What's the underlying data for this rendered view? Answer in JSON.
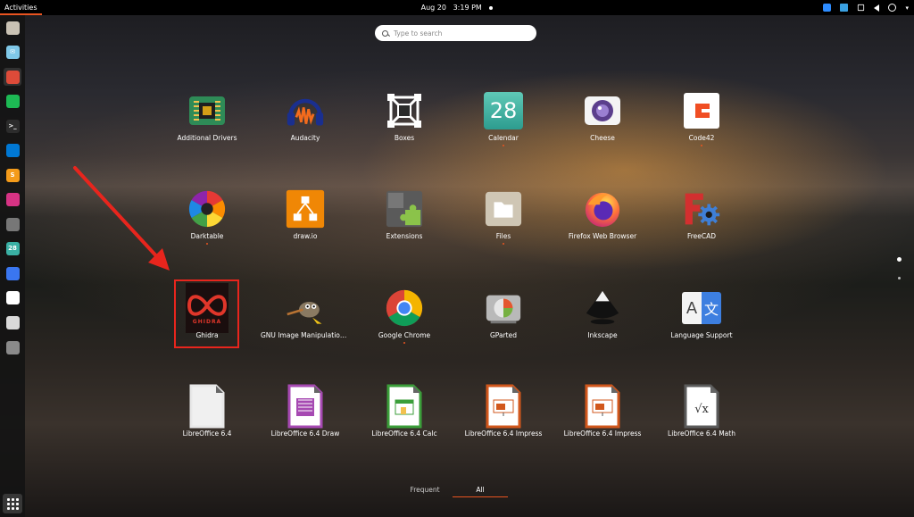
{
  "topbar": {
    "activities": "Activities",
    "date": "Aug 20",
    "time": "3:19 PM",
    "tray_icons": [
      "zoom-icon",
      "camera-icon",
      "network-icon",
      "volume-icon",
      "power-icon"
    ],
    "menu_caret": "▾"
  },
  "search": {
    "placeholder": "Type to search"
  },
  "apps": [
    {
      "label": "Additional Drivers",
      "icon": "chip-icon",
      "running": false
    },
    {
      "label": "Audacity",
      "icon": "headphones-icon",
      "running": false
    },
    {
      "label": "Boxes",
      "icon": "boxes-icon",
      "running": false
    },
    {
      "label": "Calendar",
      "icon": "calendar-icon",
      "calendar_day": "28",
      "running": true
    },
    {
      "label": "Cheese",
      "icon": "camera-icon",
      "running": false
    },
    {
      "label": "Code42",
      "icon": "code42-icon",
      "running": true
    },
    {
      "label": "Darktable",
      "icon": "aperture-icon",
      "running": true
    },
    {
      "label": "draw.io",
      "icon": "diagram-icon",
      "running": false
    },
    {
      "label": "Extensions",
      "icon": "puzzle-icon",
      "running": false
    },
    {
      "label": "Files",
      "icon": "folder-icon",
      "running": true
    },
    {
      "label": "Firefox Web Browser",
      "icon": "firefox-icon",
      "running": false
    },
    {
      "label": "FreeCAD",
      "icon": "freecad-icon",
      "running": false
    },
    {
      "label": "Ghidra",
      "icon": "ghidra-icon",
      "icon_text": "GHIDRA",
      "running": false
    },
    {
      "label": "GNU Image Manipulation Program",
      "icon": "gimp-icon",
      "running": false
    },
    {
      "label": "Google Chrome",
      "icon": "chrome-icon",
      "running": true
    },
    {
      "label": "GParted",
      "icon": "disk-icon",
      "running": false
    },
    {
      "label": "Inkscape",
      "icon": "inkscape-icon",
      "running": false
    },
    {
      "label": "Language Support",
      "icon": "language-icon",
      "icon_text": "A",
      "icon_text2": "文",
      "running": false
    },
    {
      "label": "LibreOffice 6.4",
      "icon": "libreoffice-icon",
      "running": false
    },
    {
      "label": "LibreOffice 6.4 Draw",
      "icon": "libreoffice-draw-icon",
      "running": false
    },
    {
      "label": "LibreOffice 6.4 Calc",
      "icon": "libreoffice-calc-icon",
      "running": false
    },
    {
      "label": "LibreOffice 6.4 Impress",
      "icon": "libreoffice-impress-icon",
      "running": false
    },
    {
      "label": "LibreOffice 6.4 Impress",
      "icon": "libreoffice-impress-icon",
      "running": false
    },
    {
      "label": "LibreOffice 6.4 Math",
      "icon": "libreoffice-math-icon",
      "running": false
    }
  ],
  "dock": [
    {
      "name": "files-icon",
      "color": "#c9c2b4",
      "glyph": ""
    },
    {
      "name": "mail-icon",
      "color": "#7fc8e8",
      "glyph": "✉"
    },
    {
      "name": "chrome-icon",
      "color": "#dd4b39",
      "glyph": ""
    },
    {
      "name": "spotify-icon",
      "color": "#1db954",
      "glyph": ""
    },
    {
      "name": "terminal-icon",
      "color": "#2c2c2c",
      "glyph": ">_"
    },
    {
      "name": "vscode-icon",
      "color": "#0078d4",
      "glyph": ""
    },
    {
      "name": "sublime-icon",
      "color": "#f49b1a",
      "glyph": "S"
    },
    {
      "name": "darktable-icon",
      "color": "#d63384",
      "glyph": ""
    },
    {
      "name": "gimp-icon",
      "color": "#777",
      "glyph": ""
    },
    {
      "name": "calendar-icon",
      "color": "#3ab0a4",
      "glyph": "28"
    },
    {
      "name": "signal-icon",
      "color": "#3a76f0",
      "glyph": ""
    },
    {
      "name": "code42-icon",
      "color": "#ffffff",
      "glyph": ""
    },
    {
      "name": "lo-impress-icon",
      "color": "#d9d9d9",
      "glyph": ""
    },
    {
      "name": "trash-icon",
      "color": "#8a8a8a",
      "glyph": ""
    }
  ],
  "bottom_tabs": {
    "frequent": "Frequent",
    "all": "All"
  },
  "colors": {
    "accent": "#e95420",
    "highlight": "#e8251d"
  }
}
